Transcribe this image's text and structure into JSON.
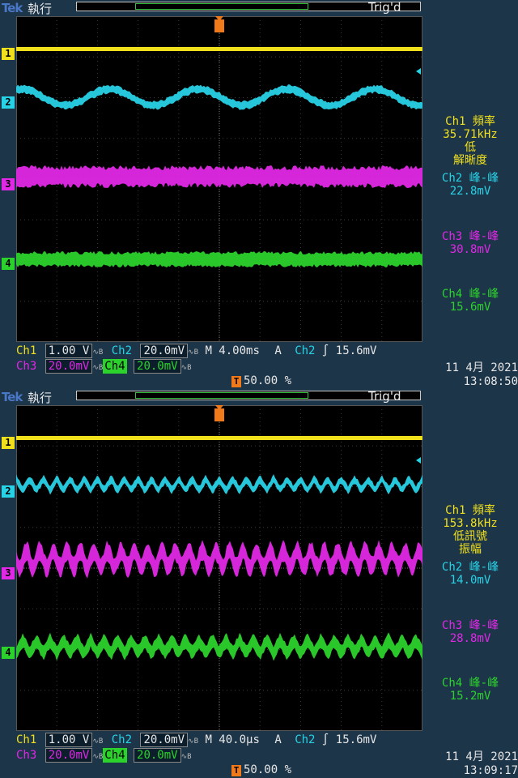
{
  "colors": {
    "ch1": "#f0e01c",
    "ch2": "#28d2e6",
    "ch3": "#e028e6",
    "ch4": "#2cd22c",
    "trigger": "#f07a1a",
    "grid": "#3c3c3c"
  },
  "panels": [
    {
      "logo": "Tek",
      "run_label": "執行",
      "trig_state": "Trig'd",
      "markers": [
        "1",
        "2",
        "3",
        "4"
      ],
      "readouts": [
        {
          "line1": "Ch1 頻率",
          "line2": "35.71kHz",
          "line3": "低",
          "line4": "解晰度"
        },
        {
          "line1": "Ch2 峰-峰",
          "line2": "22.8mV"
        },
        {
          "line1": "Ch3 峰-峰",
          "line2": "30.8mV"
        },
        {
          "line1": "Ch4 峰-峰",
          "line2": "15.6mV"
        }
      ],
      "bottom": {
        "ch1": "Ch1",
        "ch1_scale": "1.00 V",
        "ch2": "Ch2",
        "ch2_scale": "20.0mV",
        "timebase": "M 4.00ms",
        "acq": "A",
        "trig_ch": "Ch2",
        "trig_slope": "∫",
        "trig_level": "15.6mV",
        "ch3": "Ch3",
        "ch3_scale": "20.0mV",
        "ch4": "Ch4",
        "ch4_scale": "20.0mV",
        "position": "50.00 %",
        "date": "11 4月  2021",
        "time": "13:08:50"
      },
      "waves": {
        "ch2_cycles": 4.6,
        "ch3_ripple": false,
        "ch4_ripple": false
      }
    },
    {
      "logo": "Tek",
      "run_label": "執行",
      "trig_state": "Trig'd",
      "markers": [
        "1",
        "2",
        "3",
        "4"
      ],
      "readouts": [
        {
          "line1": "Ch1 頻率",
          "line2": "153.8kHz",
          "line3": "低訊號",
          "line4": "振幅"
        },
        {
          "line1": "Ch2 峰-峰",
          "line2": "14.0mV"
        },
        {
          "line1": "Ch3 峰-峰",
          "line2": "28.8mV"
        },
        {
          "line1": "Ch4 峰-峰",
          "line2": "15.2mV"
        }
      ],
      "bottom": {
        "ch1": "Ch1",
        "ch1_scale": "1.00 V",
        "ch2": "Ch2",
        "ch2_scale": "20.0mV",
        "timebase": "M 40.0µs",
        "acq": "A",
        "trig_ch": "Ch2",
        "trig_slope": "∫",
        "trig_level": "15.6mV",
        "ch3": "Ch3",
        "ch3_scale": "20.0mV",
        "ch4": "Ch4",
        "ch4_scale": "20.0mV",
        "position": "50.00 %",
        "date": "11 4月  2021",
        "time": "13:09:17"
      },
      "waves": {
        "ch2_cycles": 30,
        "ch3_ripple": true,
        "ch4_ripple": true
      }
    }
  ]
}
